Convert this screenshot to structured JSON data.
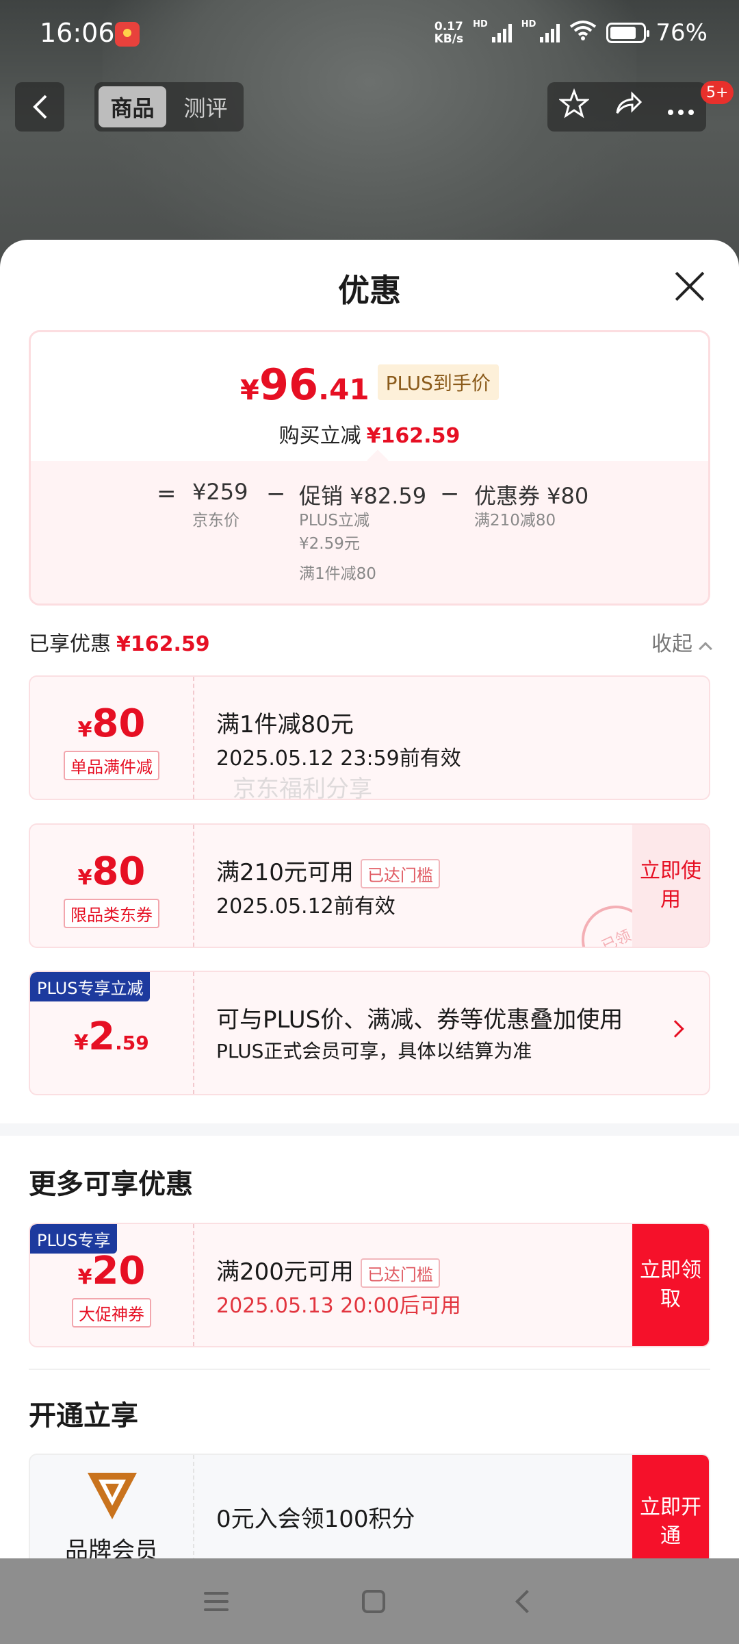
{
  "status_bar": {
    "time": "16:06",
    "net_speed_value": "0.17",
    "net_speed_unit": "KB/s",
    "hd1": "HD",
    "hd2": "HD",
    "battery": "76%"
  },
  "top_nav": {
    "tabs": [
      "商品",
      "测评"
    ],
    "active_tab": "商品",
    "badge": "5+"
  },
  "sheet": {
    "title": "优惠",
    "summary": {
      "currency": "¥",
      "price_int": "96",
      "price_dec": ".41",
      "plus_tag": "PLUS到手价",
      "reduce_label": "购买立减",
      "reduce_amount": "¥162.59",
      "eq": "=",
      "minus": "−",
      "jd_price": "¥259",
      "jd_price_label": "京东价",
      "promo": "促销 ¥82.59",
      "promo_sub1": "PLUS立减",
      "promo_sub2": "¥2.59元",
      "promo_sub3": "满1件减80",
      "coupon": "优惠券 ¥80",
      "coupon_sub": "满210减80"
    },
    "enjoyed": {
      "label": "已享优惠",
      "amount": "¥162.59",
      "collapse": "收起"
    },
    "coupons": [
      {
        "currency": "¥",
        "amount": "80",
        "tag": "单品满件减",
        "title": "满1件减80元",
        "sub": "2025.05.12 23:59前有效"
      },
      {
        "currency": "¥",
        "amount": "80",
        "tag": "限品类东券",
        "title": "满210元可用",
        "threshold": "已达门槛",
        "sub": "2025.05.12前有效",
        "button": "立即使用",
        "stamp": "已领"
      },
      {
        "corner": "PLUS专享立减",
        "currency": "¥",
        "amount": "2",
        "dec": ".59",
        "title": "可与PLUS价、满减、券等优惠叠加使用",
        "sub": "PLUS正式会员可享，具体以结算为准"
      }
    ],
    "watermark": "京东福利分享",
    "more": {
      "title": "更多可享优惠",
      "coupon": {
        "corner": "PLUS专享",
        "currency": "¥",
        "amount": "20",
        "tag": "大促神券",
        "title": "满200元可用",
        "threshold": "已达门槛",
        "sub": "2025.05.13 20:00后可用",
        "button": "立即领取"
      }
    },
    "open": {
      "title": "开通立享",
      "brand_name": "品牌会员",
      "text": "0元入会领100积分",
      "button": "立即开通"
    }
  },
  "colors": {
    "accent_red": "#e60f23",
    "plus_blue": "#1d3a9e",
    "gold": "#c9731d"
  }
}
